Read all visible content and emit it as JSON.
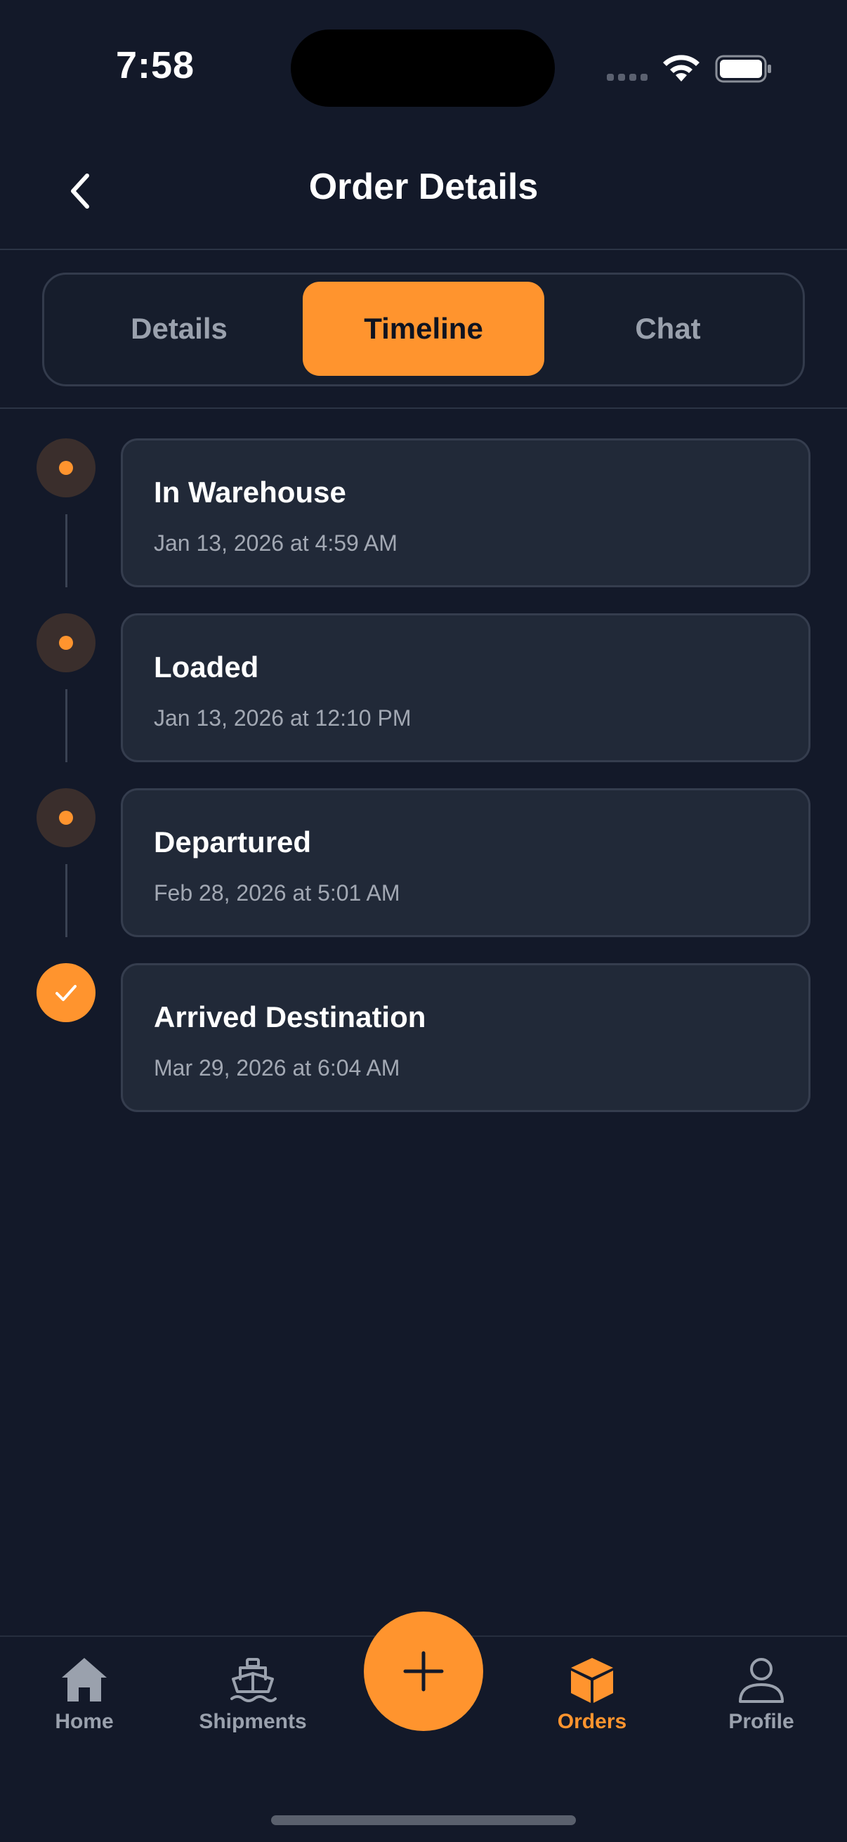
{
  "status_bar": {
    "time": "7:58"
  },
  "header": {
    "title": "Order Details"
  },
  "segments": {
    "items": [
      {
        "label": "Details"
      },
      {
        "label": "Timeline",
        "active": true
      },
      {
        "label": "Chat"
      }
    ]
  },
  "timeline": {
    "items": [
      {
        "title": "In Warehouse",
        "date": "Jan 13, 2026 at 4:59 AM",
        "status": "pending"
      },
      {
        "title": "Loaded",
        "date": "Jan 13, 2026 at 12:10 PM",
        "status": "pending"
      },
      {
        "title": "Departured",
        "date": "Feb 28, 2026 at 5:01 AM",
        "status": "pending"
      },
      {
        "title": "Arrived Destination",
        "date": "Mar 29, 2026 at 6:04 AM",
        "status": "completed"
      }
    ]
  },
  "tabbar": {
    "home": "Home",
    "shipments": "Shipments",
    "orders": "Orders",
    "profile": "Profile",
    "active": "Orders"
  },
  "colors": {
    "background": "#131929",
    "accent": "#ff942e",
    "card": "#212938",
    "muted_text": "#a2a8b3"
  },
  "icons": [
    "back-chevron-icon",
    "wifi-icon",
    "battery-icon",
    "check-icon",
    "home-icon",
    "ship-icon",
    "plus-icon",
    "box-icon",
    "person-icon"
  ]
}
